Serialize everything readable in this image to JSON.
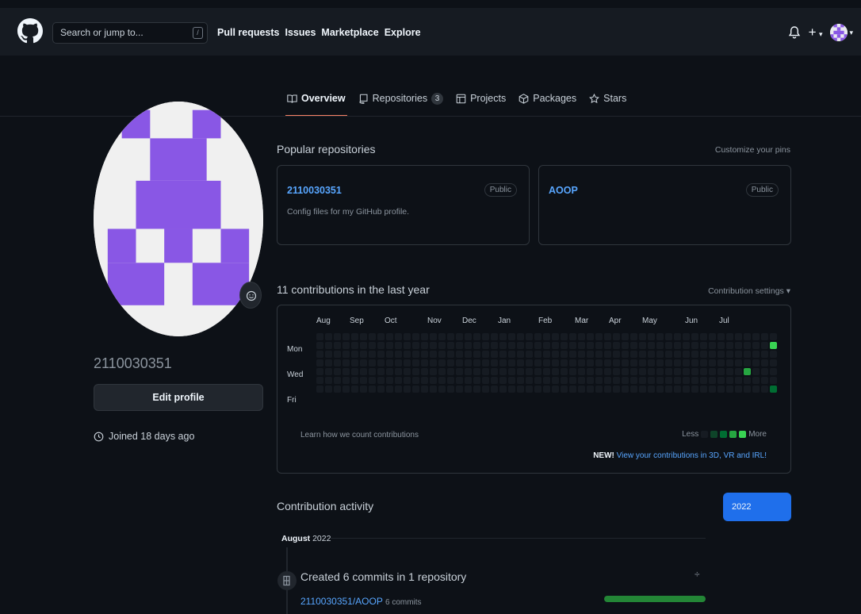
{
  "header": {
    "search_placeholder": "Search or jump to...",
    "slash_key": "/",
    "nav": [
      "Pull requests",
      "Issues",
      "Marketplace",
      "Explore"
    ],
    "plus": "+"
  },
  "tabs": [
    {
      "label": "Overview",
      "icon": "book-icon",
      "active": true
    },
    {
      "label": "Repositories",
      "icon": "repo-icon",
      "count": "3"
    },
    {
      "label": "Projects",
      "icon": "table-icon"
    },
    {
      "label": "Packages",
      "icon": "package-icon"
    },
    {
      "label": "Stars",
      "icon": "star-icon"
    }
  ],
  "profile": {
    "username": "2110030351",
    "edit_label": "Edit profile",
    "joined": "Joined 18 days ago"
  },
  "popular": {
    "title": "Popular repositories",
    "customize": "Customize your pins",
    "repos": [
      {
        "name": "2110030351",
        "desc": "Config files for my GitHub profile.",
        "visibility": "Public"
      },
      {
        "name": "AOOP",
        "desc": "",
        "visibility": "Public"
      }
    ]
  },
  "contributions": {
    "title": "11 contributions in the last year",
    "settings": "Contribution settings ▾",
    "months": [
      "Aug",
      "Sep",
      "Oct",
      "Nov",
      "Dec",
      "Jan",
      "Feb",
      "Mar",
      "Apr",
      "May",
      "Jun",
      "Jul"
    ],
    "days": [
      "Mon",
      "Wed",
      "Fri"
    ],
    "learn": "Learn how we count contributions",
    "less": "Less",
    "more": "More",
    "new_label": "NEW!",
    "new_link": "View your contributions in 3D, VR and IRL!",
    "colors": {
      "empty": "#161b22",
      "l1": "#0e4429",
      "l2": "#006d32",
      "l3": "#26a641",
      "l4": "#39d353"
    }
  },
  "activity": {
    "title": "Contribution activity",
    "year": "2022",
    "month_bold": "August",
    "month_year": "2022",
    "commit_title": "Created 6 commits in 1 repository",
    "commit_repo": "2110030351/AOOP",
    "commit_count": "6 commits"
  }
}
